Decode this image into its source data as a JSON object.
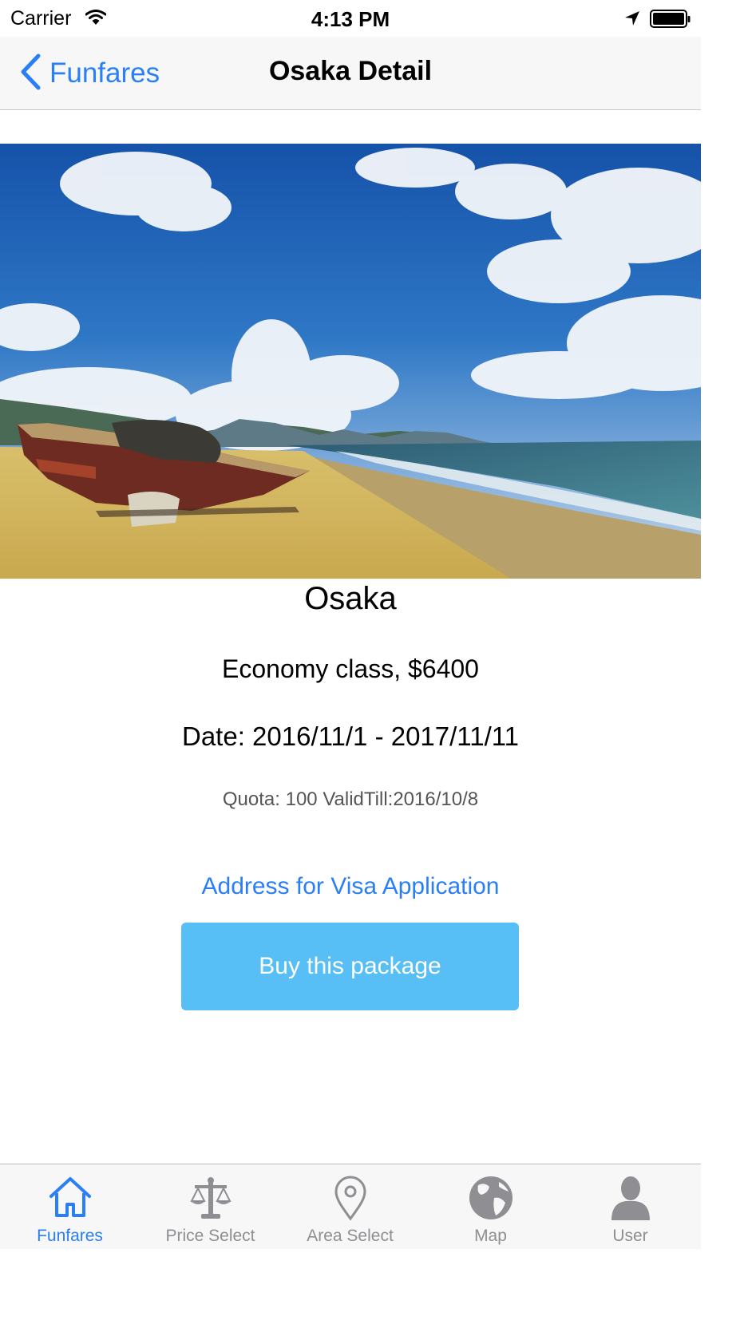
{
  "status_bar": {
    "carrier": "Carrier",
    "time": "4:13 PM",
    "icons": [
      "wifi-icon",
      "location-arrow-icon",
      "battery-icon"
    ]
  },
  "nav": {
    "back_label": "Funfares",
    "title": "Osaka Detail",
    "back_icon": "chevron-left-icon"
  },
  "detail": {
    "city": "Osaka",
    "fare": "Economy class, $6400",
    "dates": "Date: 2016/11/1 - 2017/11/11",
    "quota": "Quota: 100 ValidTill:2016/10/8",
    "visa_link": "Address for Visa Application",
    "buy_label": "Buy this package"
  },
  "tabs": [
    {
      "label": "Funfares",
      "icon": "home-icon",
      "active": true
    },
    {
      "label": "Price Select",
      "icon": "scales-icon",
      "active": false
    },
    {
      "label": "Area Select",
      "icon": "map-pin-icon",
      "active": false
    },
    {
      "label": "Map",
      "icon": "globe-icon",
      "active": false
    },
    {
      "label": "User",
      "icon": "user-icon",
      "active": false
    }
  ],
  "colors": {
    "accent": "#2a7ff6",
    "button": "#57bff5",
    "tab_inactive": "#8e8e93"
  }
}
